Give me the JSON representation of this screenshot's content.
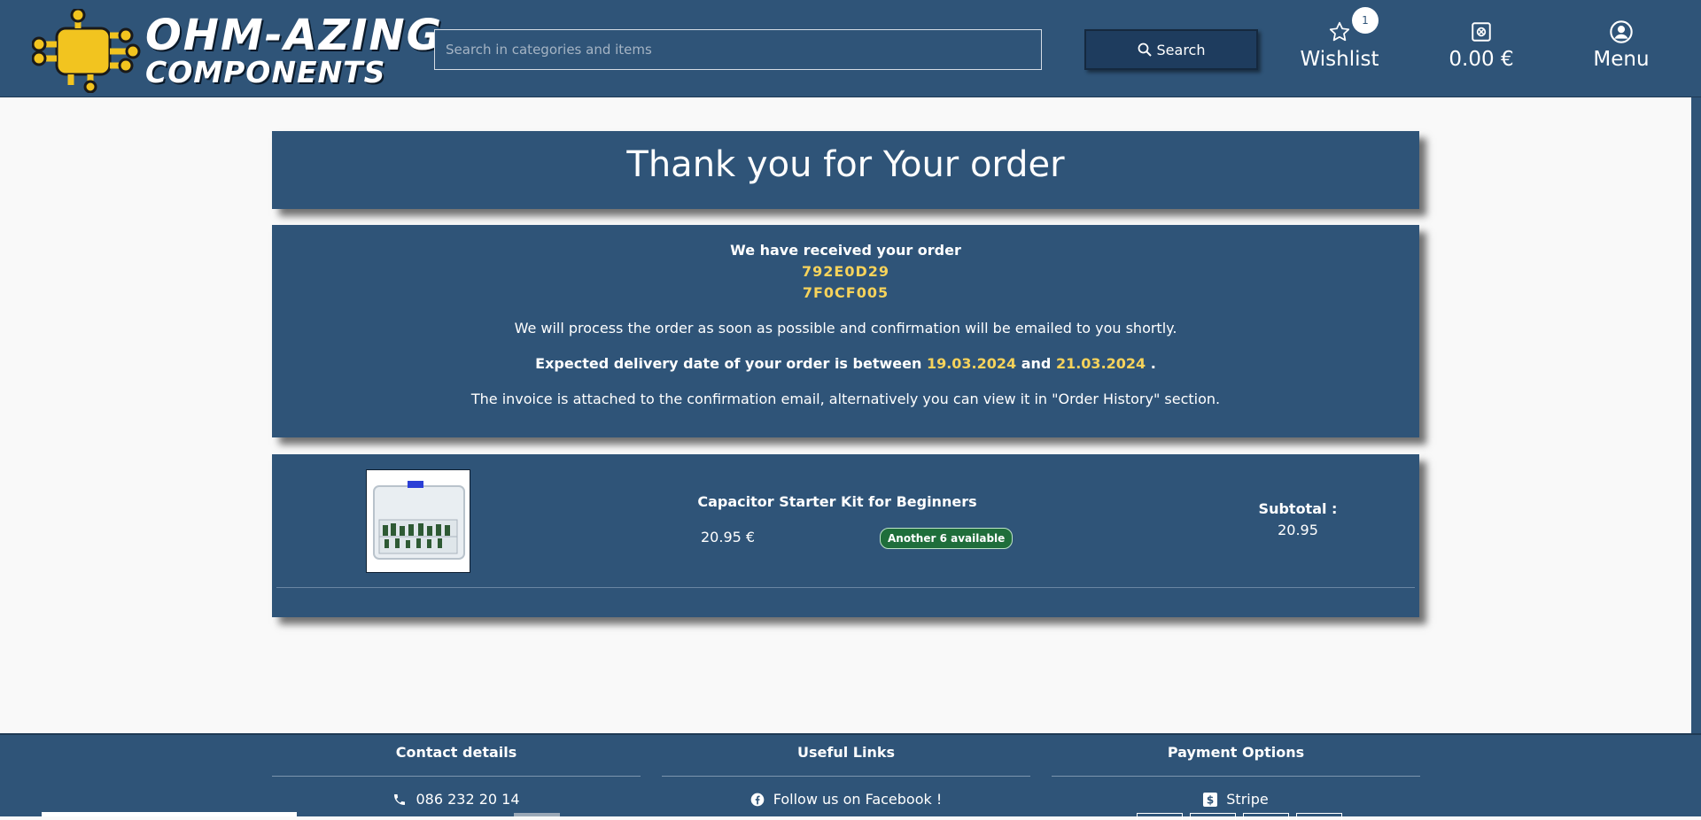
{
  "header": {
    "logo_line1": "OHM-AZING",
    "logo_line2": "COMPONENTS",
    "search_placeholder": "Search in categories and items",
    "search_button_label": "Search",
    "wishlist_label": "Wishlist",
    "wishlist_count": "1",
    "cart_label": "0.00 €",
    "menu_label": "Menu"
  },
  "title": "Thank you for Your order",
  "confirmation": {
    "heading": "We have received your order",
    "order_codes": [
      "792E0D29",
      "7F0CF005"
    ],
    "process_message": "We will process the order as soon as possible and confirmation will be emailed to you shortly.",
    "delivery_prefix": "Expected delivery date of your order is between",
    "delivery_from": "19.03.2024",
    "delivery_and": "and",
    "delivery_to": "21.03.2024",
    "delivery_suffix": ".",
    "invoice_message": "The invoice is attached to the confirmation email, alternatively you can view it in \"Order History\" section."
  },
  "order_item": {
    "name": "Capacitor Starter Kit for Beginners",
    "price": "20.95 €",
    "stock_badge": "Another 6 available",
    "subtotal_label": "Subtotal :",
    "subtotal_value": "20.95"
  },
  "footer": {
    "contact_heading": "Contact details",
    "phone": "086 232 20 14",
    "links_heading": "Useful Links",
    "facebook_link": "Follow us on Facebook !",
    "payment_heading": "Payment Options",
    "payment_stripe": "Stripe"
  },
  "colors": {
    "brand_blue": "#2f5478",
    "accent_yellow": "#f7d35b",
    "stock_green": "#1f6e3b"
  },
  "icons": [
    "circuit-chip-logo-icon",
    "search-icon",
    "star-icon",
    "cart-icon",
    "user-circle-icon",
    "phone-icon",
    "facebook-icon",
    "stripe-icon"
  ]
}
